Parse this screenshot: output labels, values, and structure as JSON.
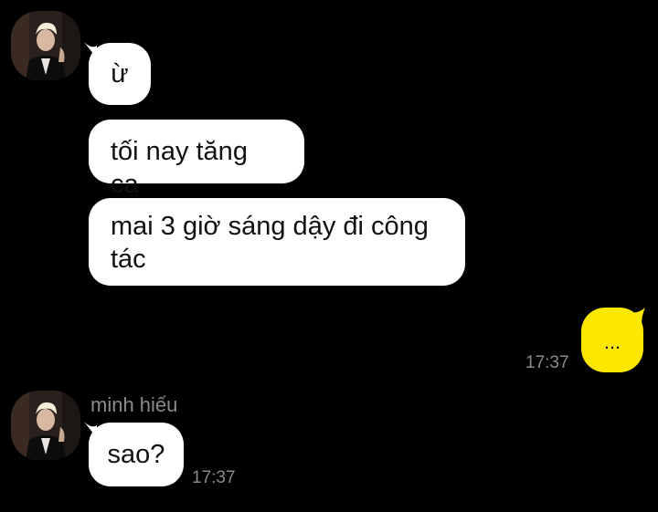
{
  "conversation": {
    "group1": {
      "avatar_icon": "profile-photo-icon",
      "messages": [
        {
          "text": "ừ"
        },
        {
          "text": "tối nay tăng ca"
        },
        {
          "text": "mai 3 giờ sáng dậy đi công tác"
        }
      ]
    },
    "outgoing": {
      "text": "...",
      "time": "17:37",
      "bubble_color": "#fde700"
    },
    "group2": {
      "sender_name": "minh hiếu",
      "avatar_icon": "profile-photo-icon",
      "message": {
        "text": "sao?",
        "time": "17:37"
      }
    }
  },
  "colors": {
    "background": "#000000",
    "incoming_bubble": "#ffffff",
    "outgoing_bubble": "#fde700",
    "meta_text": "#8a8a8a"
  }
}
